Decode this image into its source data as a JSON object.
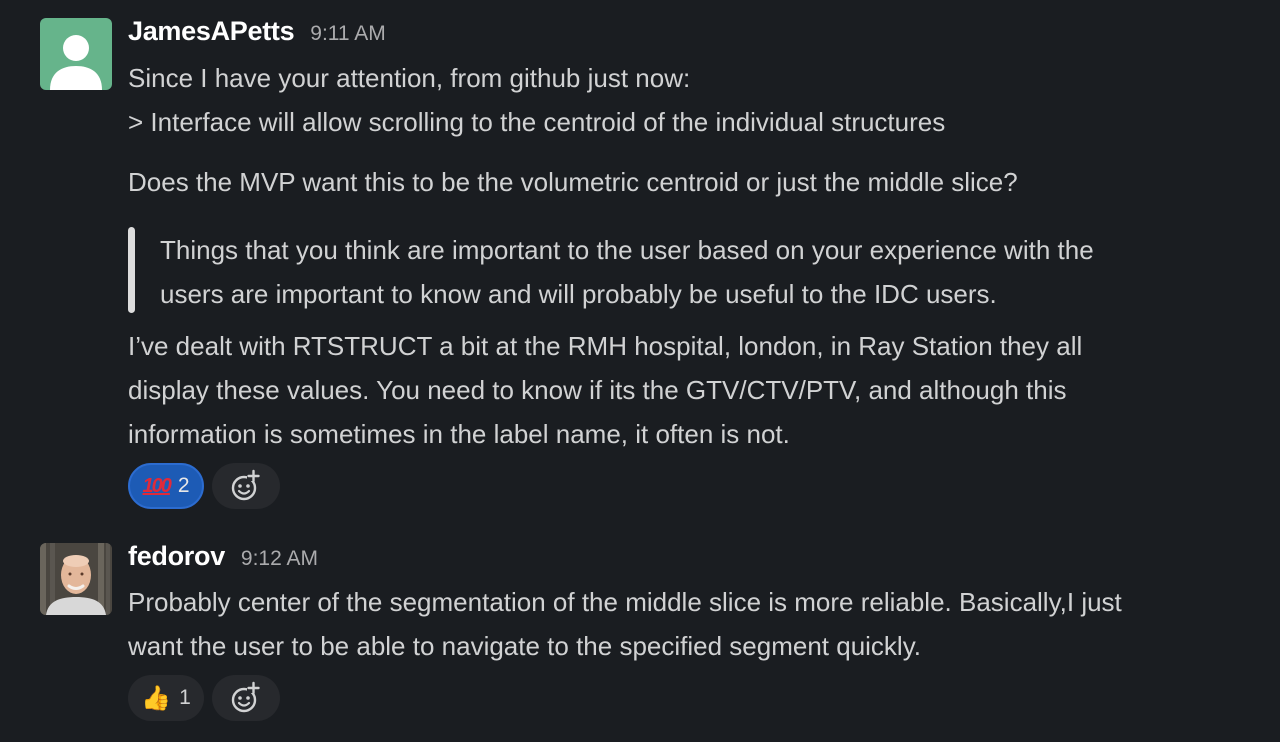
{
  "messages": [
    {
      "author": "JamesAPetts",
      "time": "9:11 AM",
      "lines": [
        "Since I have your attention, from github just now:",
        "> Interface will allow scrolling to the centroid of the individual structures",
        "Does the MVP want this to be the volumetric centroid or just the middle slice?"
      ],
      "quote": [
        " Things that you think are important to the user based on your experience with the",
        "users are important to know and will probably be useful to the IDC users."
      ],
      "after_quote": [
        "I’ve dealt with RTSTRUCT a bit at the RMH hospital, london, in Ray Station they all",
        "display these values. You need to know if its the GTV/CTV/PTV, and although this",
        "information is sometimes in the label name, it often is not."
      ],
      "reactions": [
        {
          "emoji": "💯",
          "icon": "hundred-points-emoji",
          "count": "2",
          "active": true
        }
      ]
    },
    {
      "author": "fedorov",
      "time": "9:12 AM",
      "lines": [
        "Probably center of the segmentation of the middle slice is more reliable. Basically,I  just",
        "want the user to be able to navigate to the specified segment quickly."
      ],
      "reactions": [
        {
          "emoji": "👍",
          "icon": "thumbs-up-emoji",
          "count": "1",
          "active": false
        }
      ]
    }
  ],
  "colors": {
    "background": "#1a1d21",
    "text": "#d1d2d3",
    "author": "#ffffff",
    "timestamp": "#ababad",
    "reaction_active": "#1d5bb5",
    "reaction_plain": "#27292d",
    "default_avatar": "#66b48b"
  }
}
